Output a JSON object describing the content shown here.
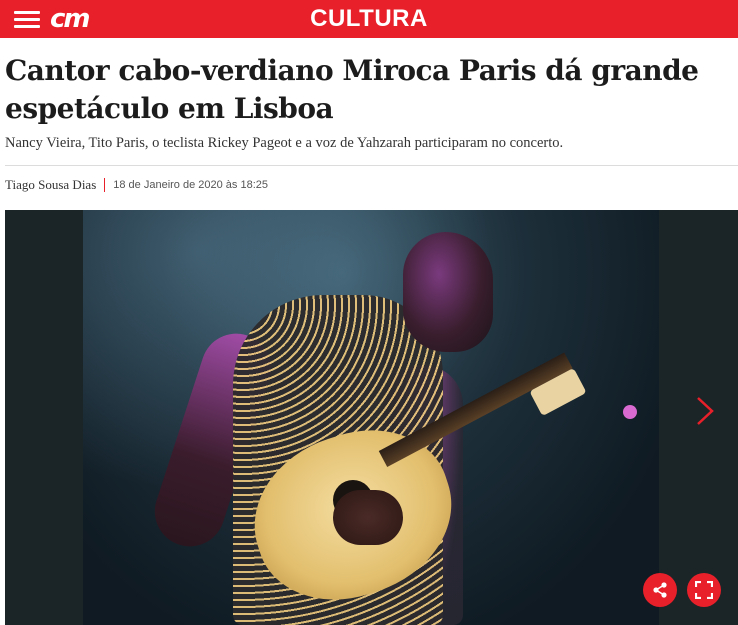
{
  "header": {
    "logo_text": "cm",
    "section": "CULTURA",
    "menu_icon": "hamburger-menu-icon",
    "brand_color": "#e8202a"
  },
  "article": {
    "headline": "Cantor cabo-verdiano Miroca Paris dá grande espetáculo em Lisboa",
    "lead": "Nancy Vieira, Tito Paris, o teclista Rickey Pageot e a voz de Yahzarah participaram no concerto.",
    "author": "Tiago Sousa Dias",
    "date": "18 de Janeiro de 2020 às 18:25"
  },
  "gallery": {
    "next_icon": "chevron-right-icon",
    "share_icon": "share-icon",
    "fullscreen_icon": "fullscreen-icon"
  }
}
